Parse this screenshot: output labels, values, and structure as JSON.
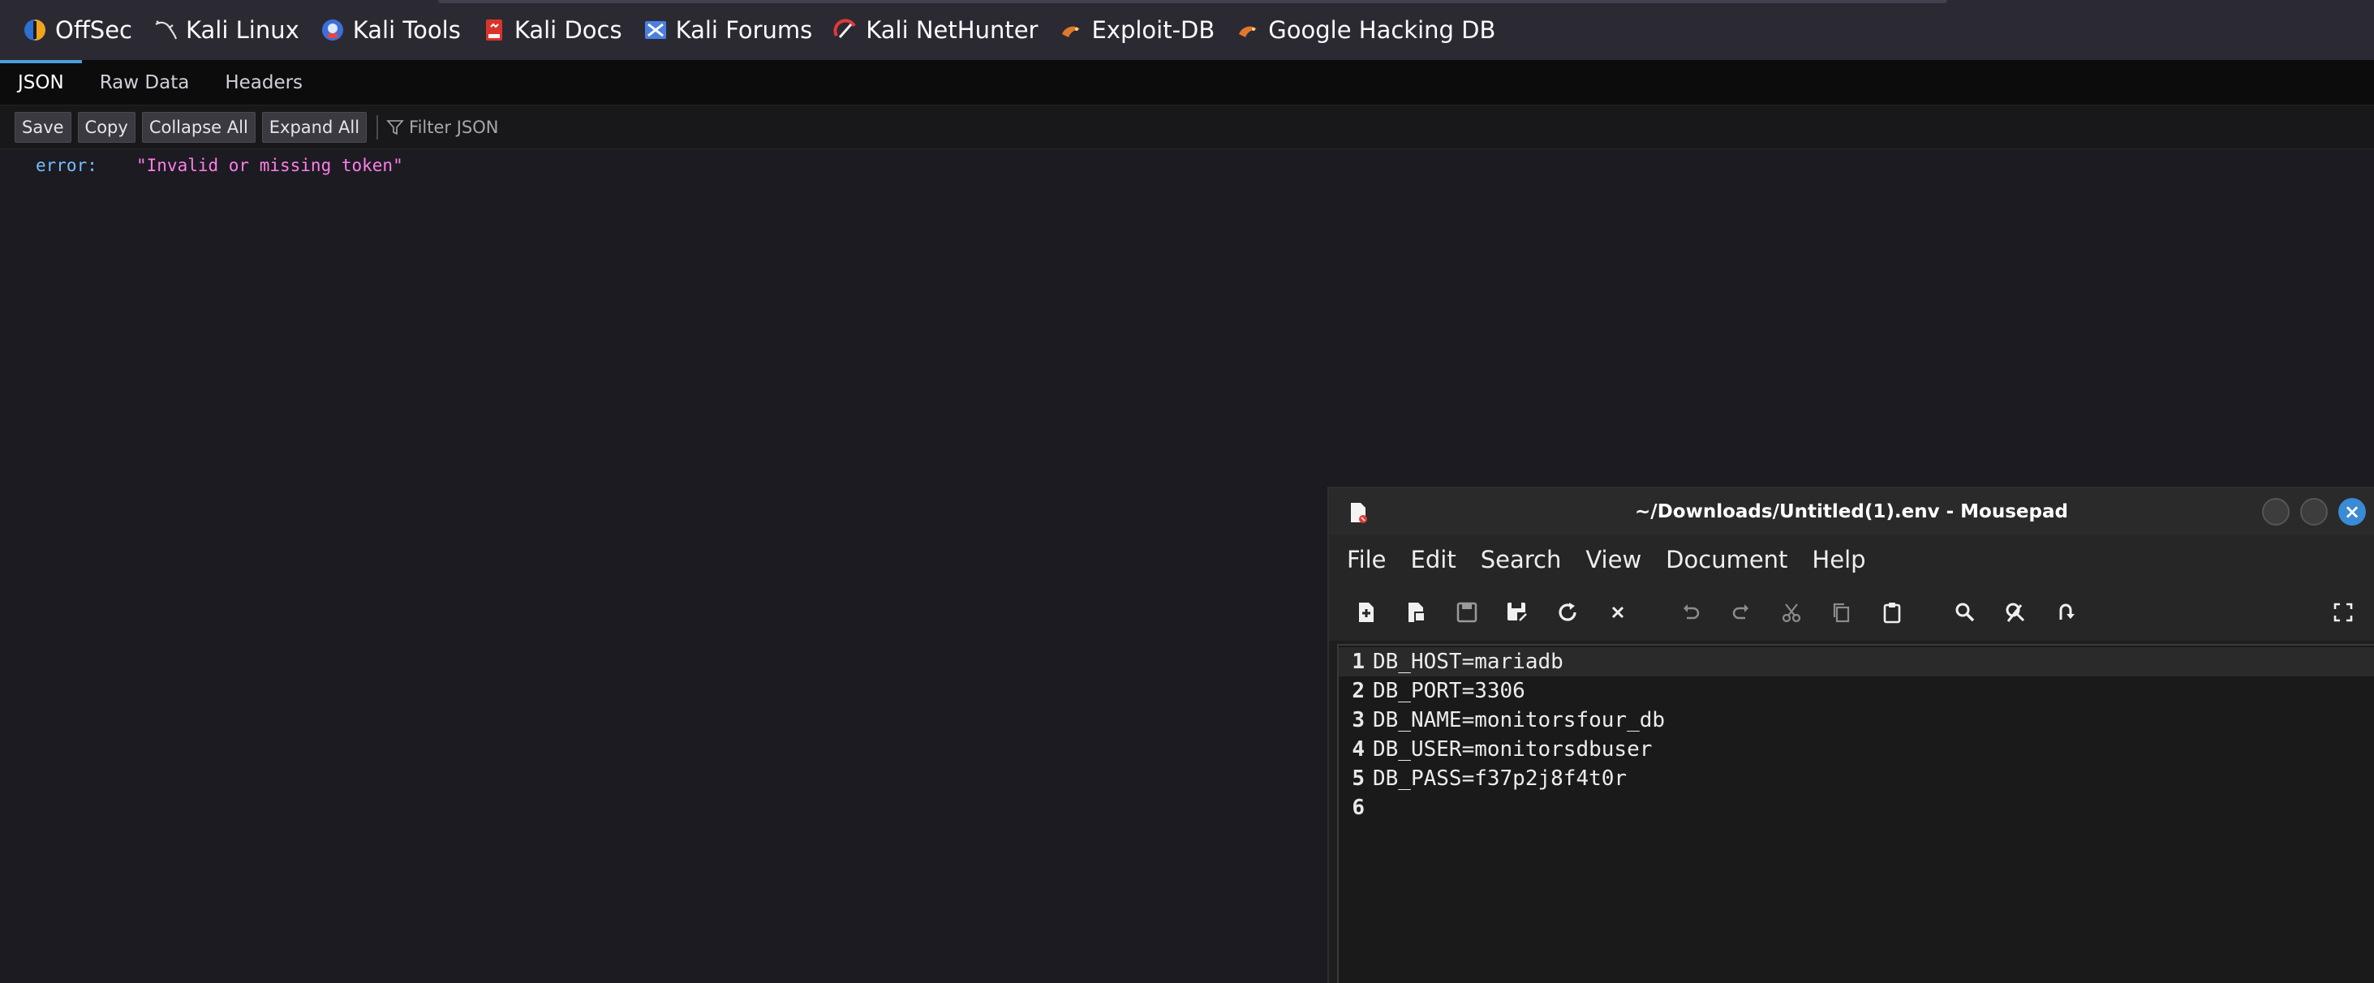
{
  "bookmarks": [
    {
      "label": "OffSec",
      "icon": "offsec-icon"
    },
    {
      "label": "Kali Linux",
      "icon": "kali-dragon-icon"
    },
    {
      "label": "Kali Tools",
      "icon": "kali-tools-icon"
    },
    {
      "label": "Kali Docs",
      "icon": "kali-docs-icon"
    },
    {
      "label": "Kali Forums",
      "icon": "kali-forums-icon"
    },
    {
      "label": "Kali NetHunter",
      "icon": "nethunter-icon"
    },
    {
      "label": "Exploit-DB",
      "icon": "exploit-db-icon"
    },
    {
      "label": "Google Hacking DB",
      "icon": "ghdb-icon"
    }
  ],
  "viewer": {
    "tabs": [
      "JSON",
      "Raw Data",
      "Headers"
    ],
    "active_tab": "JSON",
    "toolbar": {
      "save": "Save",
      "copy": "Copy",
      "collapse_all": "Collapse All",
      "expand_all": "Expand All",
      "filter_placeholder": "Filter JSON"
    },
    "json": {
      "key": "error:",
      "value": "\"Invalid or missing token\""
    }
  },
  "mousepad": {
    "title": "~/Downloads/Untitled(1).env - Mousepad",
    "menu": [
      "File",
      "Edit",
      "Search",
      "View",
      "Document",
      "Help"
    ],
    "toolbar_icons": [
      "new-document-icon",
      "new-window-icon",
      "save-icon",
      "save-as-icon",
      "reload-icon",
      "close-tab-icon",
      "undo-icon",
      "redo-icon",
      "cut-icon",
      "copy-icon",
      "paste-icon",
      "find-icon",
      "find-replace-icon",
      "go-to-line-icon",
      "fullscreen-icon"
    ],
    "lines": [
      {
        "num": "1",
        "text": "DB_HOST=mariadb"
      },
      {
        "num": "2",
        "text": "DB_PORT=3306"
      },
      {
        "num": "3",
        "text": "DB_NAME=monitorsfour_db"
      },
      {
        "num": "4",
        "text": "DB_USER=monitorsdbuser"
      },
      {
        "num": "5",
        "text": "DB_PASS=f37p2j8f4t0r"
      },
      {
        "num": "6",
        "text": ""
      }
    ],
    "current_line": 1,
    "colors": {
      "accent": "#3a8ad6",
      "close": "#3a8ad6"
    }
  }
}
